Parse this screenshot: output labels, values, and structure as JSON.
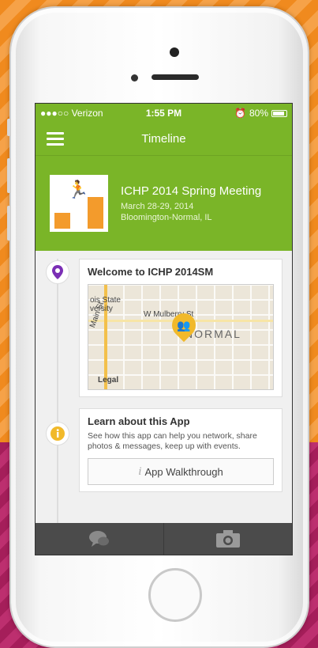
{
  "status": {
    "carrier": "●●●○○ Verizon",
    "time": "1:55 PM",
    "battery": "80%"
  },
  "nav": {
    "title": "Timeline"
  },
  "event": {
    "name": "ICHP 2014 Spring Meeting",
    "dates": "March 28-29, 2014",
    "location": "Bloomington-Normal, IL"
  },
  "cards": {
    "welcome": {
      "title": "Welcome to ICHP 2014SM",
      "map_labels": {
        "street1": "W Mulberry St",
        "street2": "Main St",
        "area": "NORMAL",
        "campus": "ois State\nversity",
        "legal": "Legal"
      }
    },
    "learn": {
      "title": "Learn about this App",
      "desc": "See how this app can help you network, share photos & messages, keep up with events.",
      "button_label": "App Walkthrough"
    }
  },
  "colors": {
    "brand_green": "#7ab528",
    "accent_purple": "#7b2fb5",
    "accent_yellow": "#f1b92a"
  }
}
